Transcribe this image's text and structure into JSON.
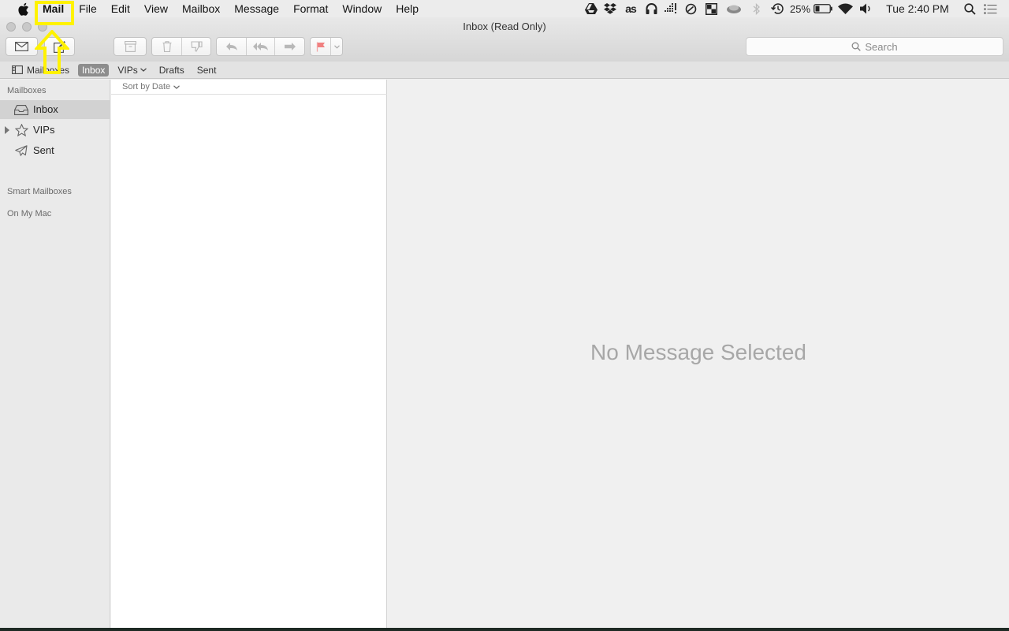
{
  "menubar": {
    "app_name": "Mail",
    "menus": [
      "File",
      "Edit",
      "View",
      "Mailbox",
      "Message",
      "Format",
      "Window",
      "Help"
    ],
    "battery_percent": "25%",
    "clock": "Tue 2:40 PM",
    "status_icons": [
      "google-drive-icon",
      "dropbox-icon",
      "lastfm-icon",
      "headphones-icon",
      "dots-grid-icon",
      "circle-slash-icon",
      "checker-icon",
      "cloud-icon",
      "bluetooth-icon",
      "time-machine-icon",
      "battery-icon",
      "wifi-icon",
      "volume-icon",
      "spotlight-icon",
      "notification-center-icon"
    ]
  },
  "window": {
    "title": "Inbox (Read Only)",
    "search_placeholder": "Search"
  },
  "favorites": {
    "mailboxes": "Mailboxes",
    "inbox": "Inbox",
    "vips": "VIPs",
    "drafts": "Drafts",
    "sent": "Sent"
  },
  "sidebar": {
    "section_mailboxes": "Mailboxes",
    "items": [
      {
        "label": "Inbox",
        "icon": "inbox-tray-icon",
        "selected": true
      },
      {
        "label": "VIPs",
        "icon": "star-icon",
        "selected": false
      },
      {
        "label": "Sent",
        "icon": "paper-plane-icon",
        "selected": false
      }
    ],
    "section_smart": "Smart Mailboxes",
    "section_onmymac": "On My Mac"
  },
  "message_list": {
    "sort_label": "Sort by Date"
  },
  "preview": {
    "empty_text": "No Message Selected"
  },
  "annotation": {
    "highlight_color": "#fff200"
  }
}
